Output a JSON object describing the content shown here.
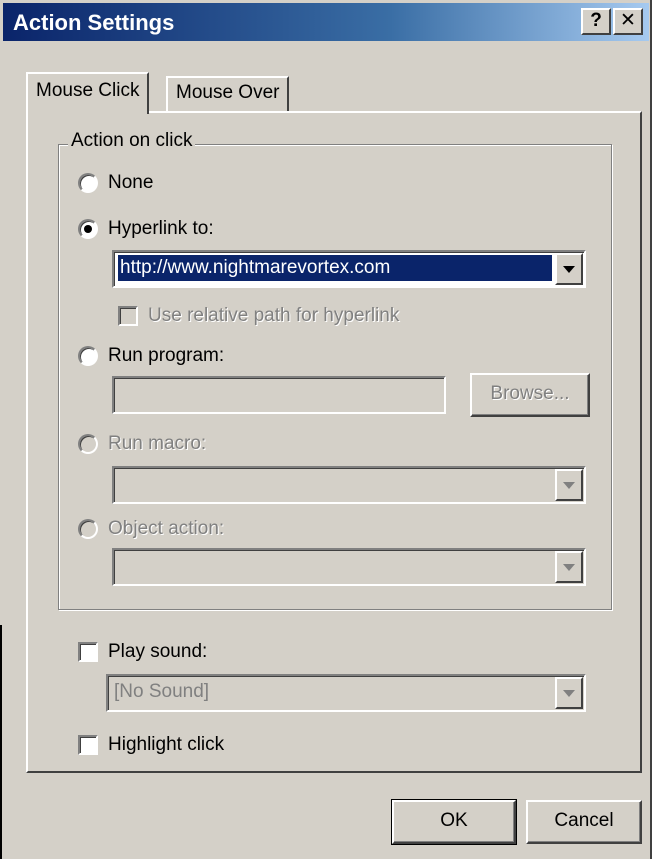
{
  "window": {
    "title": "Action Settings",
    "help_label": "?",
    "close_label": "✕"
  },
  "tabs": [
    {
      "label": "Mouse Click",
      "active": true
    },
    {
      "label": "Mouse Over",
      "active": false
    }
  ],
  "action_group": {
    "legend": "Action on click",
    "options": [
      {
        "id": "none",
        "label": "None",
        "selected": false,
        "enabled": true
      },
      {
        "id": "hyperlink",
        "label": "Hyperlink to:",
        "selected": true,
        "enabled": true
      },
      {
        "id": "run_program",
        "label": "Run program:",
        "selected": false,
        "enabled": true
      },
      {
        "id": "run_macro",
        "label": "Run macro:",
        "selected": false,
        "enabled": false
      },
      {
        "id": "object_action",
        "label": "Object action:",
        "selected": false,
        "enabled": false
      }
    ],
    "hyperlink_value": "http://www.nightmarevortex.com",
    "relative_path_label": "Use relative path for hyperlink",
    "run_program_value": "",
    "browse_label": "Browse...",
    "run_macro_value": "",
    "object_action_value": ""
  },
  "play_sound": {
    "label": "Play sound:",
    "checked": false,
    "value": "[No Sound]"
  },
  "highlight_click": {
    "label": "Highlight click",
    "checked": false
  },
  "footer": {
    "ok_label": "OK",
    "cancel_label": "Cancel"
  },
  "colors": {
    "face": "#d4d0c8",
    "title_start": "#0a246a",
    "title_end": "#a6caf0",
    "selection": "#0a246a"
  }
}
